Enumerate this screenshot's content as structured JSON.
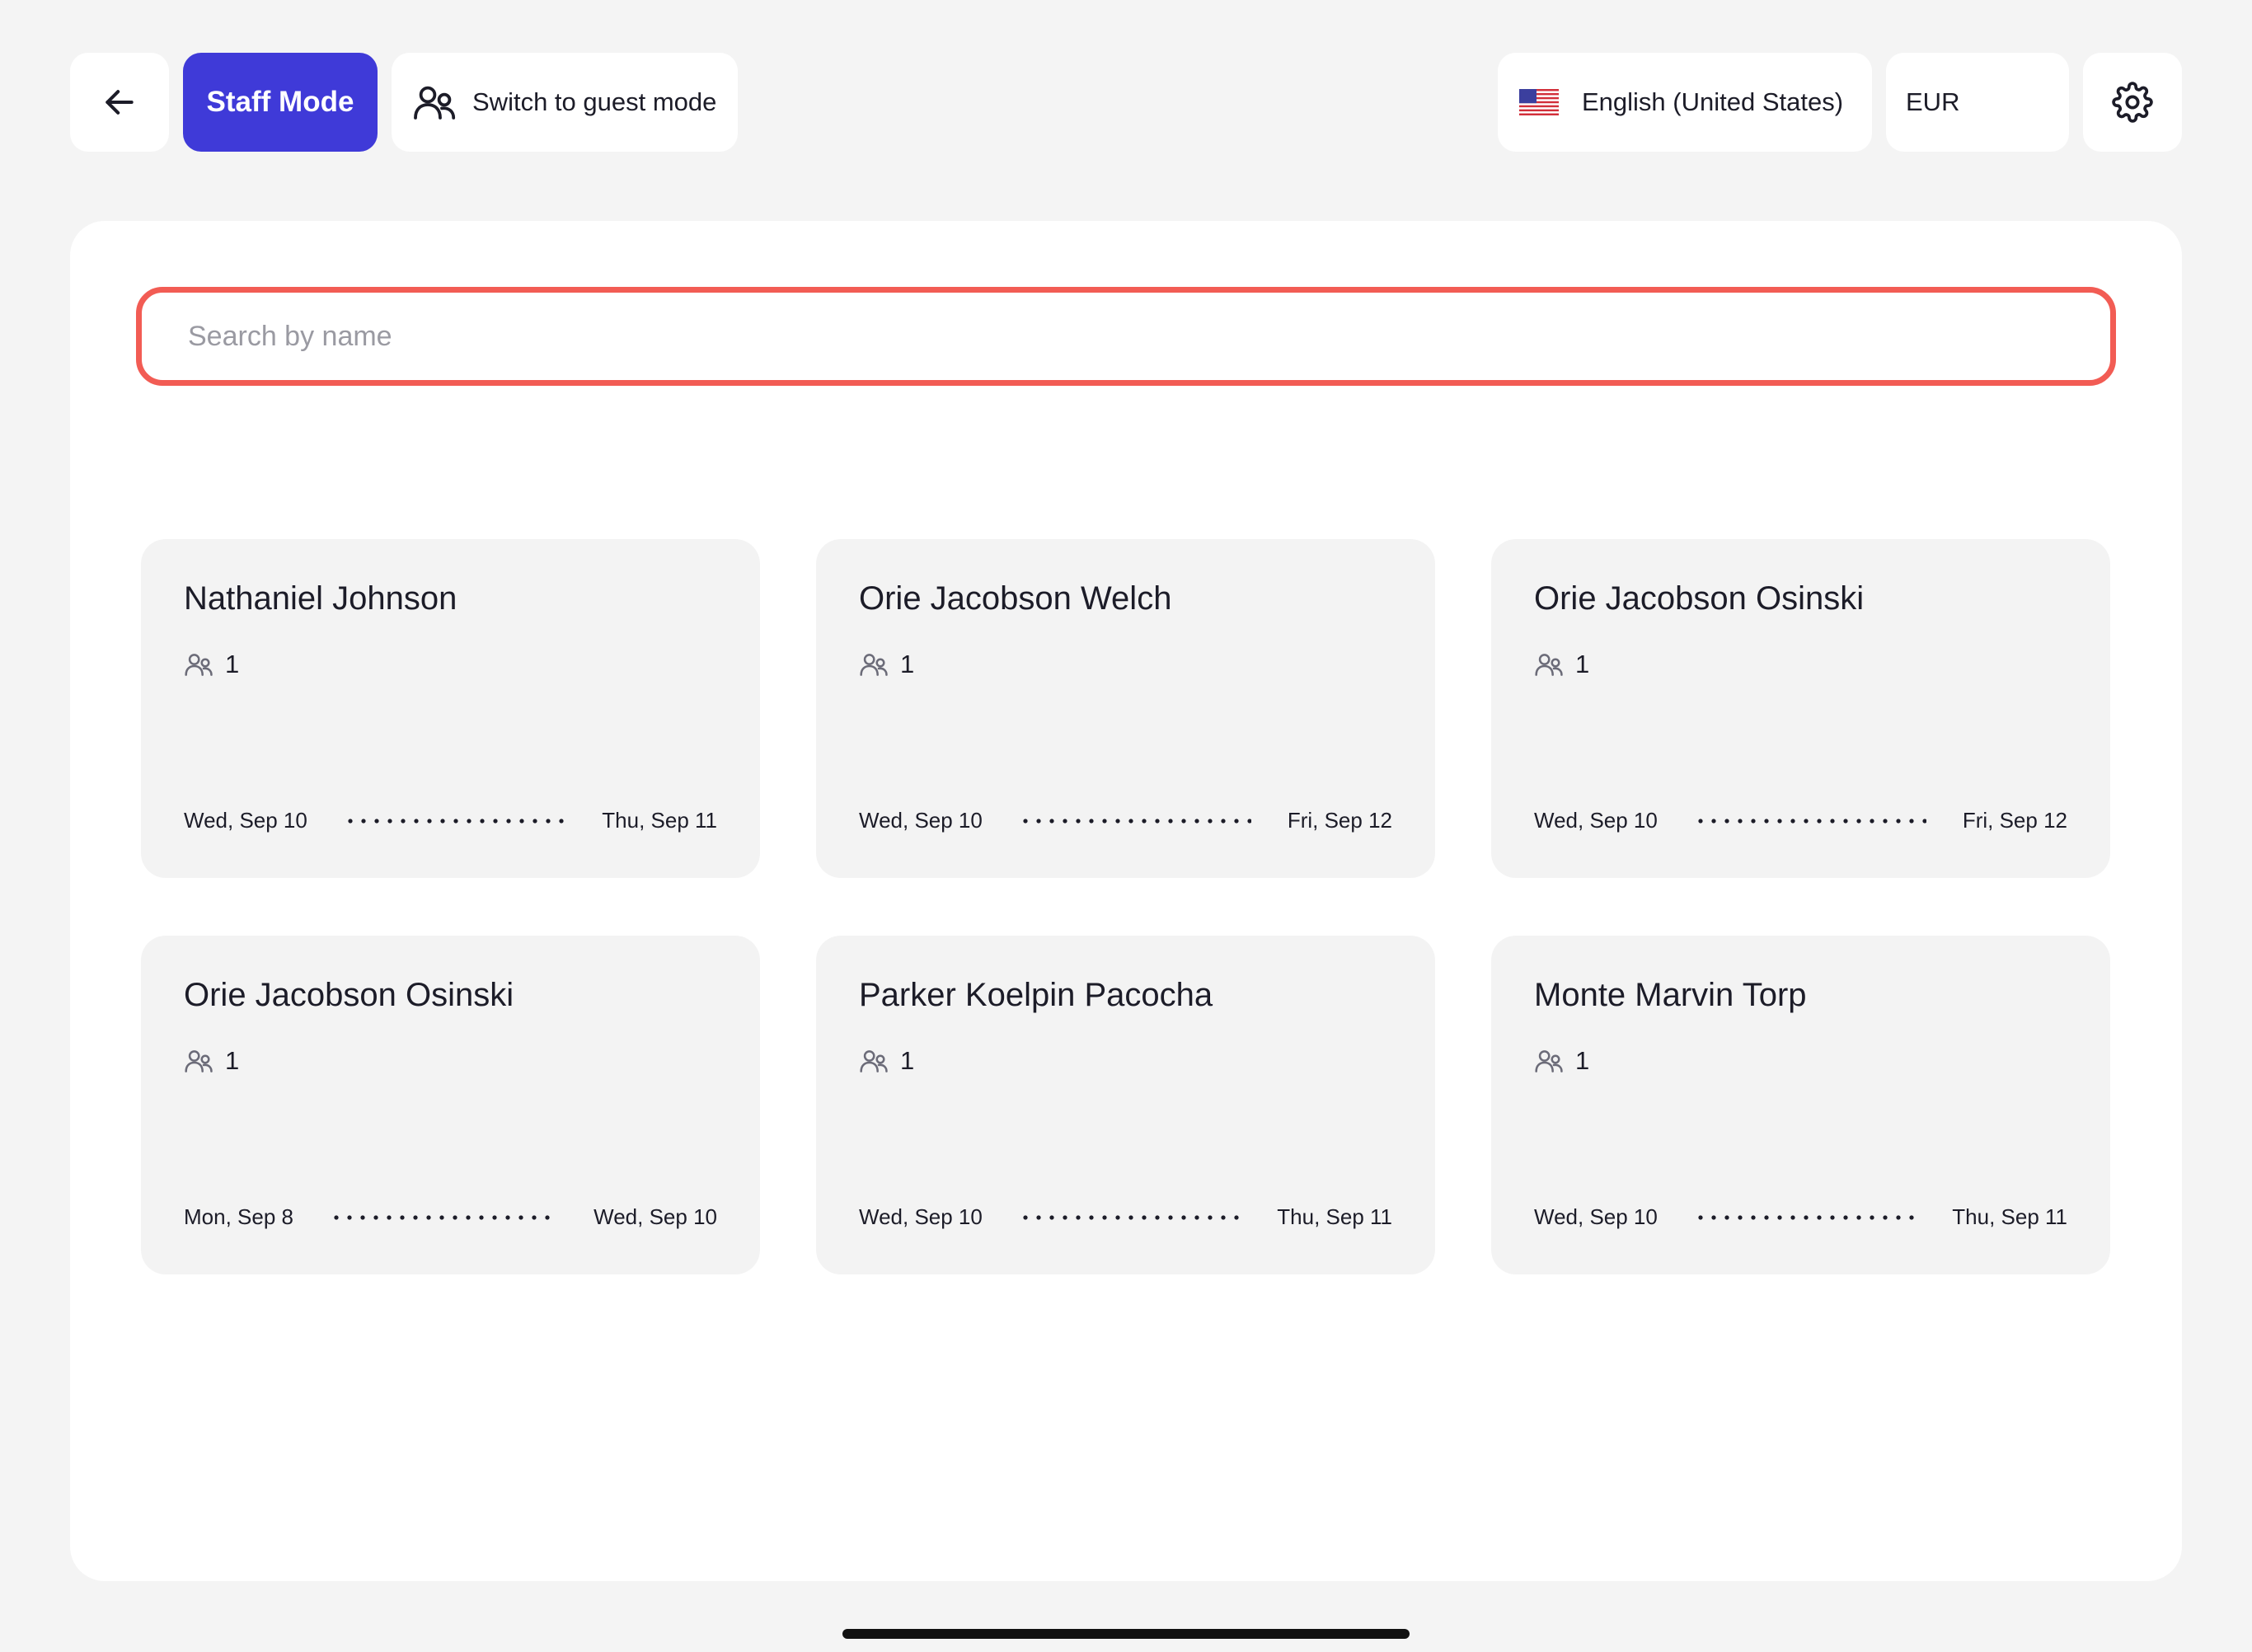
{
  "topbar": {
    "back_icon": "arrow-left-icon",
    "staff_mode_label": "Staff Mode",
    "guest_mode_label": "Switch to guest mode",
    "guest_icon": "users-icon",
    "language_label": "English (United States)",
    "flag_icon": "us-flag-icon",
    "currency_label": "EUR",
    "settings_icon": "gear-icon"
  },
  "search": {
    "placeholder": "Search by name",
    "value": ""
  },
  "reservations": [
    {
      "name": "Nathaniel Johnson",
      "guests": "1",
      "check_in": "Wed, Sep 10",
      "check_out": "Thu, Sep 11"
    },
    {
      "name": "Orie Jacobson Welch",
      "guests": "1",
      "check_in": "Wed, Sep 10",
      "check_out": "Fri, Sep 12"
    },
    {
      "name": "Orie Jacobson Osinski",
      "guests": "1",
      "check_in": "Wed, Sep 10",
      "check_out": "Fri, Sep 12"
    },
    {
      "name": "Orie Jacobson Osinski",
      "guests": "1",
      "check_in": "Mon, Sep 8",
      "check_out": "Wed, Sep 10"
    },
    {
      "name": "Parker Koelpin Pacocha",
      "guests": "1",
      "check_in": "Wed, Sep 10",
      "check_out": "Thu, Sep 11"
    },
    {
      "name": "Monte Marvin Torp",
      "guests": "1",
      "check_in": "Wed, Sep 10",
      "check_out": "Thu, Sep 11"
    }
  ],
  "colors": {
    "accent": "#3f3ad8",
    "search_border": "#f25c54",
    "background": "#f4f4f4",
    "card": "#f3f3f3"
  }
}
